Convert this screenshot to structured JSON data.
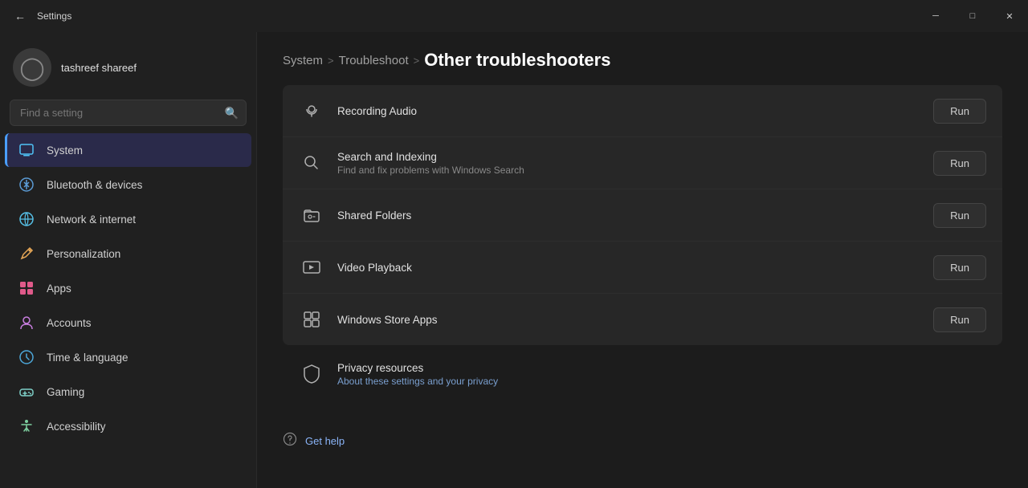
{
  "titlebar": {
    "title": "Settings",
    "minimize": "─",
    "maximize": "□",
    "close": "✕",
    "back_icon": "←"
  },
  "sidebar": {
    "username": "tashreef shareef",
    "search_placeholder": "Find a setting",
    "nav_items": [
      {
        "id": "system",
        "label": "System",
        "icon": "💻",
        "icon_class": "icon-system",
        "active": true
      },
      {
        "id": "bluetooth",
        "label": "Bluetooth & devices",
        "icon": "🔵",
        "icon_class": "icon-bluetooth",
        "active": false
      },
      {
        "id": "network",
        "label": "Network & internet",
        "icon": "🌐",
        "icon_class": "icon-network",
        "active": false
      },
      {
        "id": "personalization",
        "label": "Personalization",
        "icon": "✏️",
        "icon_class": "icon-personalization",
        "active": false
      },
      {
        "id": "apps",
        "label": "Apps",
        "icon": "🧩",
        "icon_class": "icon-apps",
        "active": false
      },
      {
        "id": "accounts",
        "label": "Accounts",
        "icon": "👤",
        "icon_class": "icon-accounts",
        "active": false
      },
      {
        "id": "time",
        "label": "Time & language",
        "icon": "🕐",
        "icon_class": "icon-time",
        "active": false
      },
      {
        "id": "gaming",
        "label": "Gaming",
        "icon": "🎮",
        "icon_class": "icon-gaming",
        "active": false
      },
      {
        "id": "accessibility",
        "label": "Accessibility",
        "icon": "♿",
        "icon_class": "icon-accessibility",
        "active": false
      }
    ]
  },
  "breadcrumb": {
    "system": "System",
    "sep1": ">",
    "troubleshoot": "Troubleshoot",
    "sep2": ">",
    "current": "Other troubleshooters"
  },
  "troubleshooters": [
    {
      "id": "recording-audio",
      "icon": "🎙️",
      "title": "Recording Audio",
      "desc": "",
      "has_run": true
    },
    {
      "id": "search-indexing",
      "icon": "🔍",
      "title": "Search and Indexing",
      "desc": "Find and fix problems with Windows Search",
      "has_run": true
    },
    {
      "id": "shared-folders",
      "icon": "📁",
      "title": "Shared Folders",
      "desc": "",
      "has_run": true
    },
    {
      "id": "video-playback",
      "icon": "📹",
      "title": "Video Playback",
      "desc": "",
      "has_run": true
    },
    {
      "id": "windows-store-apps",
      "icon": "🪟",
      "title": "Windows Store Apps",
      "desc": "",
      "has_run": true
    }
  ],
  "run_button_label": "Run",
  "privacy": {
    "icon": "🛡️",
    "title": "Privacy resources",
    "desc": "About these settings and your privacy"
  },
  "get_help": {
    "label": "Get help"
  }
}
